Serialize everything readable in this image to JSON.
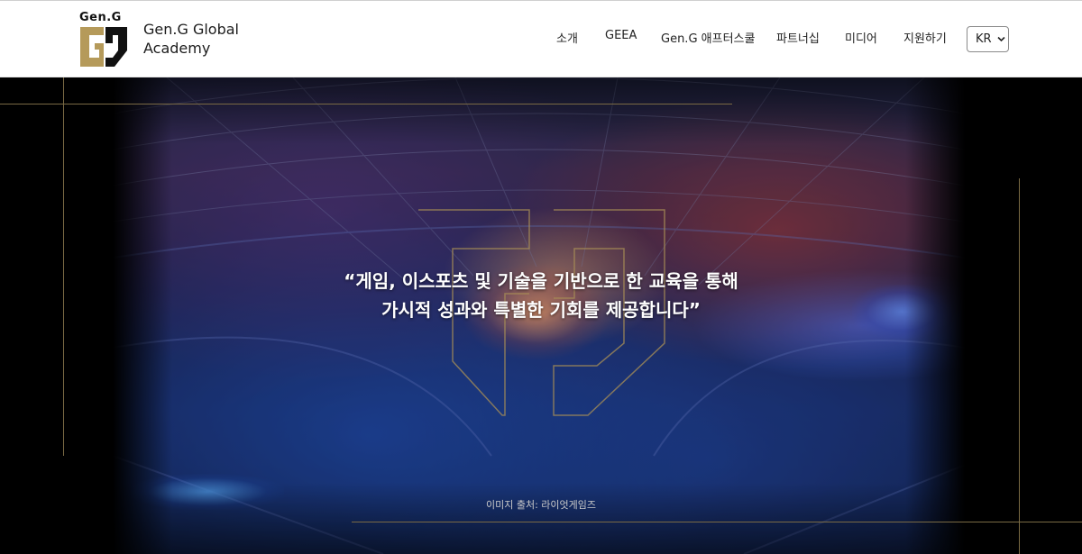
{
  "header": {
    "logo_text": "Gen.G",
    "brand_line1": "Gen.G Global",
    "brand_line2": "Academy",
    "nav": [
      {
        "label": "소개"
      },
      {
        "label": "GEEA"
      },
      {
        "label": "Gen.G 애프터스쿨"
      },
      {
        "label": "파트너십"
      },
      {
        "label": "미디어"
      },
      {
        "label": "지원하기"
      }
    ],
    "language": {
      "selected": "KR"
    }
  },
  "hero": {
    "quote_line1": "“게임, 이스포츠 및 기술을 기반으로 한 교육을 통해",
    "quote_line2": "가시적 성과와 특별한 기회를 제공합니다”",
    "image_credit": "이미지 출처: 라이엇게임즈"
  },
  "colors": {
    "gold": "#b59a5a",
    "gold_line": "#7a6a44",
    "header_bg": "#ffffff",
    "hero_bg": "#000000"
  },
  "icons": [
    "gen-g-logo-icon",
    "chevron-down-icon",
    "gen-g-emblem-outline"
  ]
}
